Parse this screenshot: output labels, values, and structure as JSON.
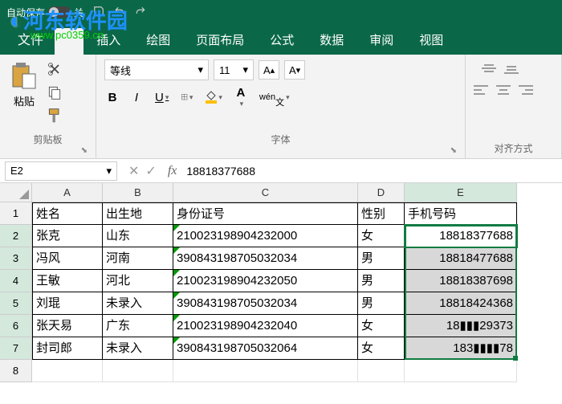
{
  "titlebar": {
    "autosave": "自动保存",
    "off": "关"
  },
  "watermark": {
    "site": "河东软件园",
    "url": "www.pc0359.cn"
  },
  "tabs": {
    "file": "文件",
    "insert": "插入",
    "draw": "绘图",
    "layout": "页面布局",
    "formulas": "公式",
    "data": "数据",
    "review": "审阅",
    "view": "视图"
  },
  "ribbon": {
    "paste": "粘贴",
    "clipboard": "剪贴板",
    "fontname": "等线",
    "fontsize": "11",
    "fontgroup": "字体",
    "aligngroup": "对齐方式",
    "wen": "wén"
  },
  "namebox": "E2",
  "formula": "18818377688",
  "columns": [
    "A",
    "B",
    "C",
    "D",
    "E"
  ],
  "header_row": [
    "姓名",
    "出生地",
    "身份证号",
    "性别",
    "手机号码"
  ],
  "rows": [
    {
      "n": "张克",
      "p": "山东",
      "id": "210023198904232000",
      "s": "女",
      "ph": "18818377688"
    },
    {
      "n": "冯风",
      "p": "河南",
      "id": "390843198705032034",
      "s": "男",
      "ph": "18818477688"
    },
    {
      "n": "王敏",
      "p": "河北",
      "id": "210023198904232050",
      "s": "男",
      "ph": "18818387698"
    },
    {
      "n": "刘琨",
      "p": "未录入",
      "id": "390843198705032034",
      "s": "男",
      "ph": "18818424368"
    },
    {
      "n": "张天易",
      "p": "广东",
      "id": "210023198904232040",
      "s": "女",
      "ph": "18▮▮▮29373"
    },
    {
      "n": "封司郎",
      "p": "未录入",
      "id": "390843198705032064",
      "s": "女",
      "ph": "183▮▮▮▮78"
    }
  ]
}
